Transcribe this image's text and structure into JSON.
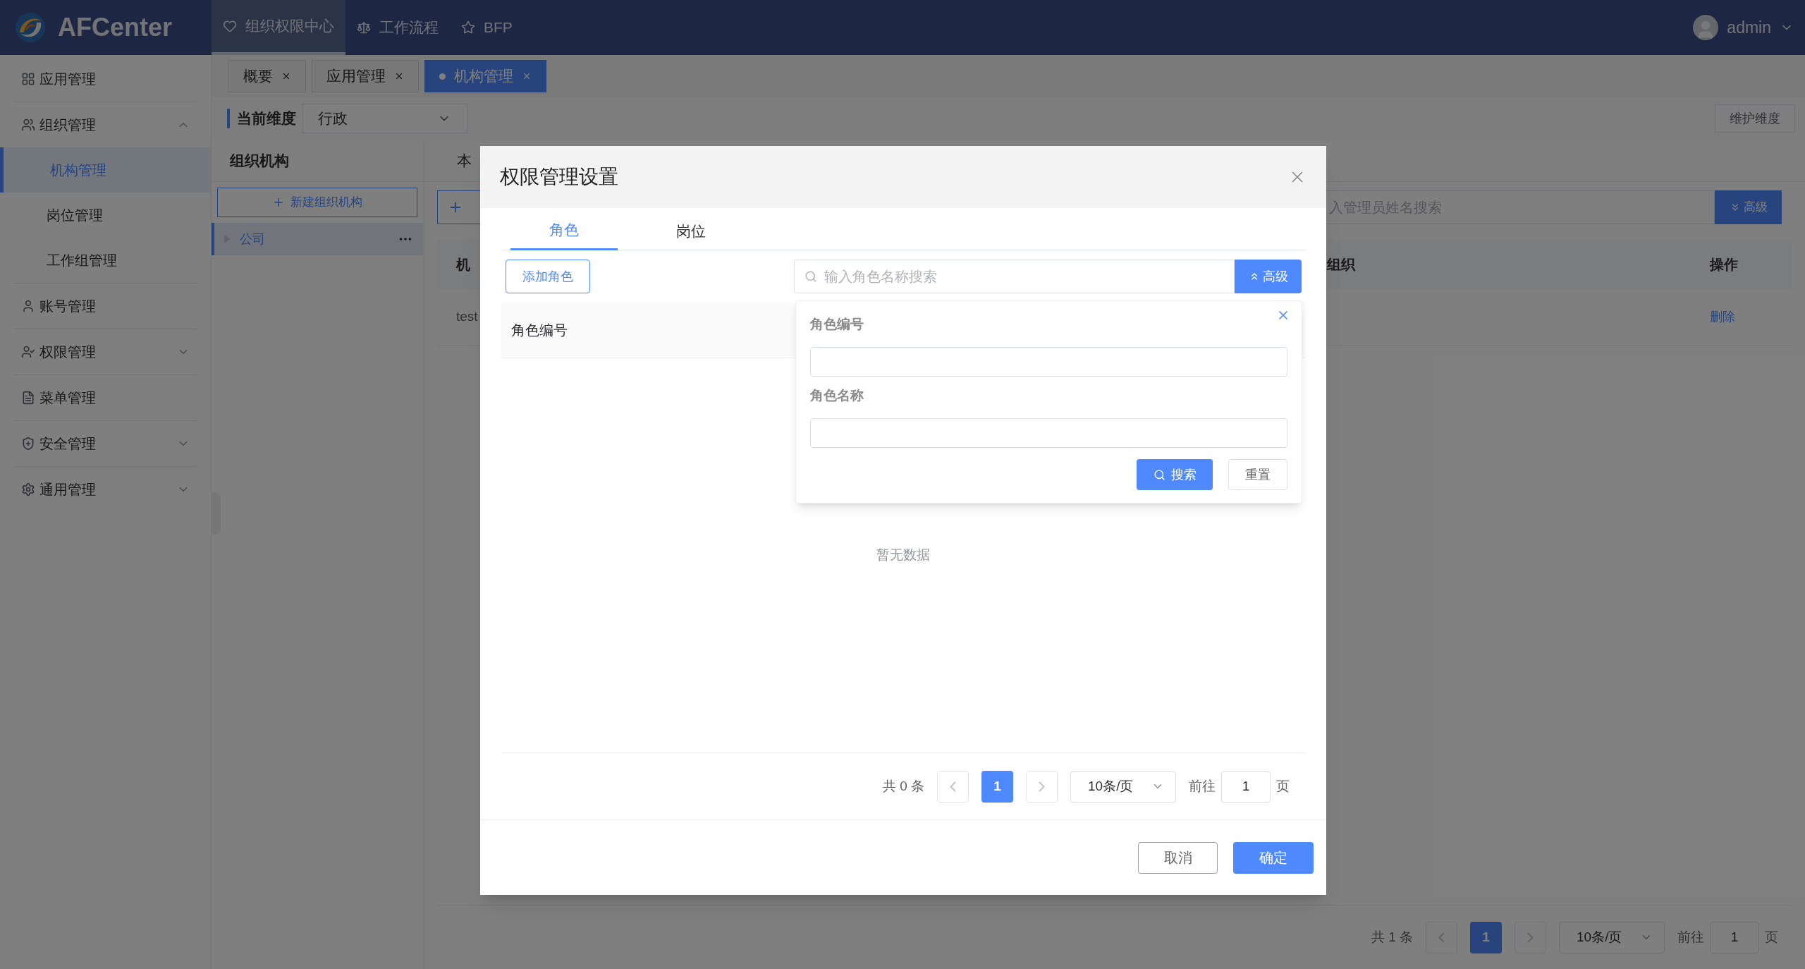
{
  "header": {
    "logo": "AFCenter",
    "nav": [
      {
        "label": "组织权限中心",
        "selected": true
      },
      {
        "label": "工作流程",
        "selected": false
      },
      {
        "label": "BFP",
        "selected": false
      }
    ],
    "user": "admin"
  },
  "sidebar": {
    "items": [
      {
        "label": "应用管理",
        "selected": false
      },
      {
        "label": "组织管理",
        "selected": false,
        "expanded": true,
        "children": [
          {
            "label": "机构管理",
            "selected": true
          },
          {
            "label": "岗位管理",
            "selected": false
          },
          {
            "label": "工作组管理",
            "selected": false
          }
        ]
      },
      {
        "label": "账号管理",
        "selected": false
      },
      {
        "label": "权限管理",
        "selected": false,
        "expanded": false
      },
      {
        "label": "菜单管理",
        "selected": false
      },
      {
        "label": "安全管理",
        "selected": false,
        "expanded": false
      },
      {
        "label": "通用管理",
        "selected": false,
        "expanded": false
      }
    ]
  },
  "page_tabs": [
    {
      "label": "概要",
      "selected": false
    },
    {
      "label": "应用管理",
      "selected": false
    },
    {
      "label": "机构管理",
      "selected": true
    }
  ],
  "dimension": {
    "label": "当前维度",
    "value": "行政",
    "maintain_button": "维护维度"
  },
  "org_panel": {
    "title": "组织机构",
    "new_button": "新建组织机构",
    "tree": [
      {
        "label": "公司",
        "selected": true
      }
    ]
  },
  "detail_panel": {
    "tab": "本",
    "search_placeholder": "入管理员姓名搜索",
    "advanced_button": "高级",
    "columns": [
      "机",
      "组织",
      "操作"
    ],
    "rows": [
      {
        "cells": [
          "test"
        ],
        "action": "删除"
      }
    ],
    "pagination": {
      "total": "共 1 条",
      "prev_disabled": true,
      "next_disabled": true,
      "pages": [
        {
          "label": "1",
          "selected": true
        }
      ],
      "page_size": "10条/页",
      "goto_label": "前往",
      "goto_value": "1",
      "page_suffix": "页"
    }
  },
  "dialog": {
    "title": "权限管理设置",
    "tabs": [
      {
        "label": "角色",
        "selected": true
      },
      {
        "label": "岗位",
        "selected": false
      }
    ],
    "add_button": "添加角色",
    "search_placeholder": "输入角色名称搜索",
    "advanced_button": "高级",
    "columns": [
      "角色编号"
    ],
    "empty_text": "暂无数据",
    "advanced_panel": {
      "fields": [
        {
          "label": "角色编号"
        },
        {
          "label": "角色名称"
        }
      ],
      "search_button": "搜索",
      "reset_button": "重置"
    },
    "pagination": {
      "total": "共 0 条",
      "prev_disabled": true,
      "next_disabled": true,
      "pages": [
        {
          "label": "1",
          "selected": true
        }
      ],
      "page_size": "10条/页",
      "goto_label": "前往",
      "goto_value": "1",
      "page_suffix": "页"
    },
    "cancel_button": "取消",
    "confirm_button": "确定"
  }
}
